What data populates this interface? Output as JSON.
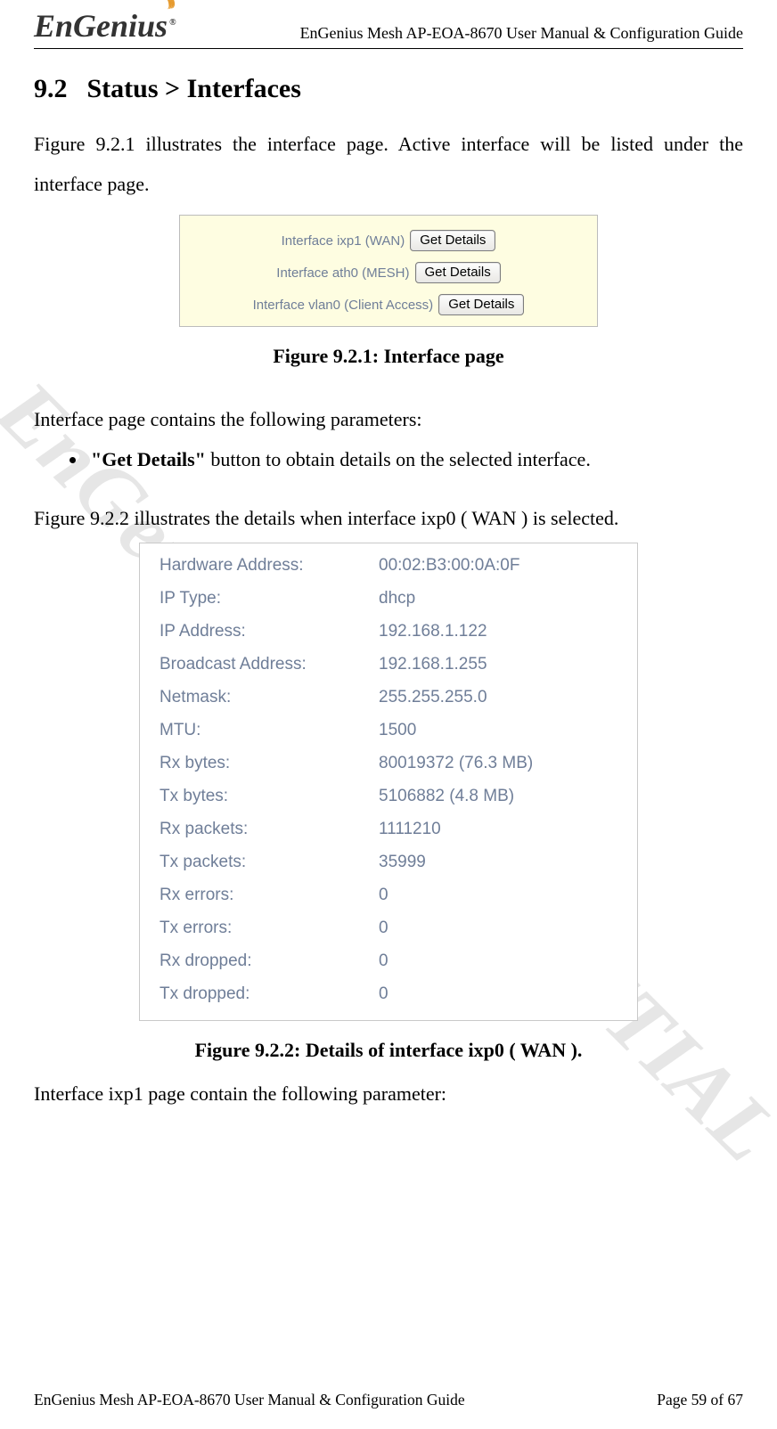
{
  "header": {
    "logo_text": "EnGenius",
    "logo_tm": "®",
    "title": "EnGenius Mesh AP-EOA-8670 User Manual & Configuration Guide"
  },
  "watermark": "EnGenius CONFIDENTIAL",
  "section": {
    "number": "9.2",
    "title": "Status > Interfaces"
  },
  "para1": "Figure 9.2.1 illustrates the interface page. Active interface will be listed under the interface page.",
  "fig921": {
    "rows": [
      {
        "label": "Interface ixp1 (WAN)",
        "button": "Get Details"
      },
      {
        "label": "Interface ath0 (MESH)",
        "button": "Get Details"
      },
      {
        "label": "Interface vlan0 (Client Access)",
        "button": "Get Details"
      }
    ],
    "caption": "Figure 9.2.1: Interface page"
  },
  "params_intro": "Interface page contains the following parameters:",
  "params_bullet_bold": "\"Get Details\"",
  "params_bullet_rest": " button to obtain details on the selected interface.",
  "para2": "Figure 9.2.2 illustrates the details when interface ixp0 ( WAN ) is selected.",
  "fig922": {
    "rows": [
      {
        "label": "Hardware Address:",
        "value": "00:02:B3:00:0A:0F"
      },
      {
        "label": "IP Type:",
        "value": "dhcp"
      },
      {
        "label": "IP Address:",
        "value": "192.168.1.122"
      },
      {
        "label": "Broadcast Address:",
        "value": "192.168.1.255"
      },
      {
        "label": "Netmask:",
        "value": "255.255.255.0"
      },
      {
        "label": "MTU:",
        "value": "1500"
      },
      {
        "label": "Rx bytes:",
        "value": "80019372 (76.3 MB)"
      },
      {
        "label": "Tx bytes:",
        "value": "5106882 (4.8 MB)"
      },
      {
        "label": "Rx packets:",
        "value": "1111210"
      },
      {
        "label": "Tx packets:",
        "value": "35999"
      },
      {
        "label": "Rx errors:",
        "value": "0"
      },
      {
        "label": "Tx errors:",
        "value": "0"
      },
      {
        "label": "Rx dropped:",
        "value": "0"
      },
      {
        "label": "Tx dropped:",
        "value": "0"
      }
    ],
    "caption": "Figure 9.2.2: Details of interface ixp0 ( WAN )."
  },
  "para3": "Interface ixp1 page contain the following parameter:",
  "footer": {
    "left": "EnGenius Mesh AP-EOA-8670 User Manual & Configuration Guide",
    "right": "Page 59 of 67"
  }
}
